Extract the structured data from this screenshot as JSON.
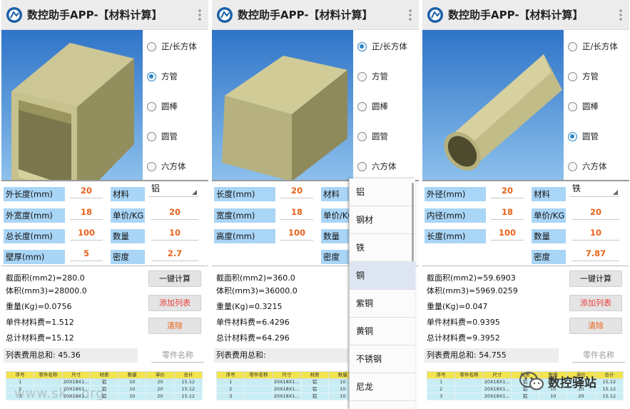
{
  "app": {
    "title": "数控助手APP-【材料计算】"
  },
  "watermark": "www.sk...org",
  "brand": {
    "wechat_label": "数控驿站",
    "icon": "wechat-icon"
  },
  "colors": {
    "accent_value": "#e8621a",
    "label_bg": "#a9d5f6",
    "header_yellow": "#f2e44f",
    "row_cyan": "#c9edf4",
    "add_button": "#e8403a"
  },
  "shape_options": [
    "正/长方体",
    "方管",
    "圆棒",
    "圆管",
    "六方体"
  ],
  "material_options": [
    "铝",
    "钢材",
    "铁",
    "铜",
    "紫铜",
    "黄铜",
    "不锈钢",
    "尼龙"
  ],
  "popup": {
    "selected": "铜"
  },
  "buttons": {
    "calc": "一键计算",
    "add": "添加列表",
    "clear": "清除"
  },
  "part_name_placeholder": "零件名称",
  "table_headers": [
    "序号",
    "零件名称",
    "尺寸",
    "材质",
    "数量",
    "单价",
    "合计"
  ],
  "table_rows": [
    [
      "1",
      "",
      "20X18X1...",
      "铝",
      "10",
      "20",
      "15.12"
    ],
    [
      "2",
      "",
      "20X18X1...",
      "铝",
      "10",
      "20",
      "15.12"
    ],
    [
      "3",
      "",
      "20X18X1...",
      "铝",
      "10",
      "20",
      "15.12"
    ]
  ],
  "panels": [
    {
      "shape": "square-tube",
      "selected_shape": "方管",
      "fields": [
        {
          "label": "外长度(mm)",
          "value": "20"
        },
        {
          "label": "外宽度(mm)",
          "value": "18"
        },
        {
          "label": "总长度(mm)",
          "value": "100"
        },
        {
          "label": "壁厚(mm)",
          "value": "5"
        }
      ],
      "material": {
        "label": "材料",
        "value": "铝"
      },
      "price": {
        "label": "单价/KG",
        "value": "20"
      },
      "qty": {
        "label": "数量",
        "value": "10"
      },
      "density": {
        "label": "密度",
        "value": "2.7"
      },
      "results": [
        "截面积(mm2)=280.0",
        "体积(mm3)=28000.0",
        "重量(Kg)=0.0756",
        "单件材料费=1.512",
        "总计材料费=15.12"
      ],
      "sum": "列表费用总和:  45.36"
    },
    {
      "shape": "block",
      "selected_shape": "正/长方体",
      "fields": [
        {
          "label": "长度(mm)",
          "value": "20"
        },
        {
          "label": "宽度(mm)",
          "value": "18"
        },
        {
          "label": "高度(mm)",
          "value": "100"
        }
      ],
      "material": {
        "label": "材料",
        "value": ""
      },
      "price": {
        "label": "单价/KG",
        "value": ""
      },
      "qty": {
        "label": "数量",
        "value": ""
      },
      "density": {
        "label": "密度",
        "value": ""
      },
      "results": [
        "截面积(mm2)=360.0",
        "体积(mm3)=36000.0",
        "重量(Kg)=0.3215",
        "单件材料费=6.4296",
        "总计材料费=64.296"
      ],
      "sum": "列表费用总和:"
    },
    {
      "shape": "round-tube",
      "selected_shape": "圆管",
      "fields": [
        {
          "label": "外径(mm)",
          "value": "20"
        },
        {
          "label": "内径(mm)",
          "value": "18"
        },
        {
          "label": "长度(mm)",
          "value": "100"
        }
      ],
      "material": {
        "label": "材料",
        "value": "铁"
      },
      "price": {
        "label": "单价/KG",
        "value": "20"
      },
      "qty": {
        "label": "数量",
        "value": "10"
      },
      "density": {
        "label": "密度",
        "value": "7.87"
      },
      "results": [
        "截面积(mm2)=59.6903",
        "体积(mm3)=5969.0259",
        "重量(Kg)=0.047",
        "单件材料费=0.9395",
        "总计材料费=9.3952"
      ],
      "sum": "列表费用总和:  54.755"
    }
  ]
}
